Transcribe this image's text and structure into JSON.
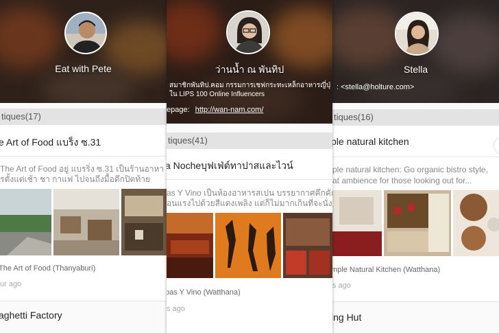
{
  "colors": {
    "accent": "#f0a060",
    "section_bar": "#e3e3e3"
  },
  "panels": [
    {
      "name": "Eat with Pete",
      "section": "tiques(17)",
      "card_title": "e Art of Food แบร็ง ซ.31",
      "desc_line1": "The Art of Food อยู่ แบรริ่ง ซ.31 เป็นร้านอาหา",
      "desc_line2": "รตั้งแต่เช้า ชา กาแฟ ไปจนถึงมื้อดึกปิดท้าย",
      "place": "The Art of Food (Thanyaburi)",
      "time": "ur ago",
      "next_title": "aghetti Factory"
    },
    {
      "name": "ว่านน้ำ ณ พันทิป",
      "bio_line1": "สมาชิกพันทิป.คอม กรรมการเชฟกระทะเหล็กอาหารญี่ปุ่",
      "bio_line2": "ใน LIPS 100 Online Influencers",
      "page_label": "epage:",
      "page_url": "http://wan-nam.com/",
      "section": "tiques(41)",
      "card_title": "a Nocheบุฟเฟ่ต์ทาปาสและไวน์",
      "desc_line1": "as Y Vino  เป็นห้องอาหารสเปน บรรยากาศคึกคัก",
      "desc_line2": "อนแรงไปด้วยสีแดงเพลิง แต่ก็ไม่มากเกินที่จะนั่ง",
      "place": "pas Y Vino (Watthana)",
      "time": "s ago"
    },
    {
      "name": "Stella",
      "email": ": <stella@holture.com>",
      "section": "tiques(16)",
      "card_title": "ple natural kitchen",
      "desc_line1": "ple natural kitchen: Go organic bistro style,",
      "desc_line2": "at ambience for those looking out for...",
      "place": "mple Natural Kitchen (Watthana)",
      "time": "s ago",
      "next_title": "ing Hut"
    }
  ]
}
